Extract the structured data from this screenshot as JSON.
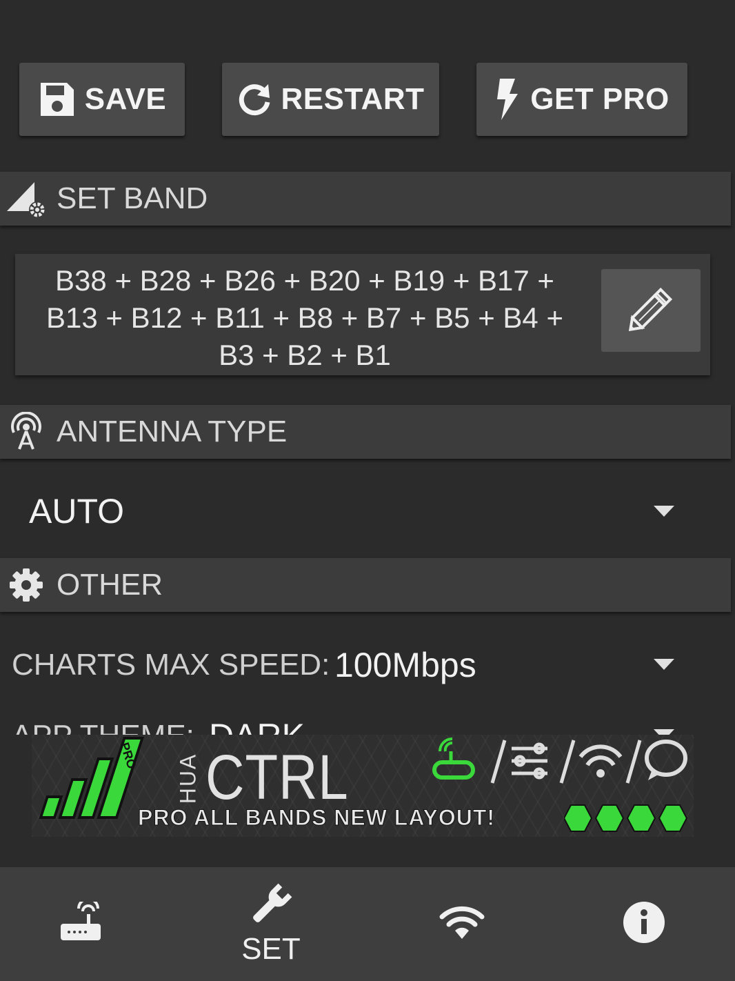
{
  "toolbar": {
    "save_label": "SAVE",
    "restart_label": "RESTART",
    "get_pro_label": "GET PRO"
  },
  "set_band": {
    "title": "SET BAND",
    "bands_line1": "B38 + B28 + B26 + B20 + B19 + B17 +",
    "bands_line2": "B13 + B12 + B11 + B8 + B7 + B5 + B4 +",
    "bands_line3": "B3 + B2 + B1"
  },
  "antenna": {
    "title": "ANTENNA TYPE",
    "selected": "AUTO"
  },
  "other": {
    "title": "OTHER",
    "charts_max_speed_label": "CHARTS MAX SPEED:",
    "charts_max_speed_value": "100Mbps",
    "app_theme_label": "APP THEME:",
    "app_theme_value": "DARK"
  },
  "banner": {
    "brand_small": "HUA",
    "brand_big": "CTRL",
    "pro_tag": "PRO",
    "tagline": "PRO ALL BANDS NEW LAYOUT!"
  },
  "bottom_nav": {
    "items": [
      {
        "icon": "router-icon",
        "label": ""
      },
      {
        "icon": "wrench-icon",
        "label": "SET"
      },
      {
        "icon": "wifi-icon",
        "label": ""
      },
      {
        "icon": "info-icon",
        "label": ""
      }
    ]
  },
  "colors": {
    "background": "#2b2b2b",
    "section": "#3c3c3c",
    "button": "#4a4a4a",
    "accent_green": "#3bd83b"
  }
}
